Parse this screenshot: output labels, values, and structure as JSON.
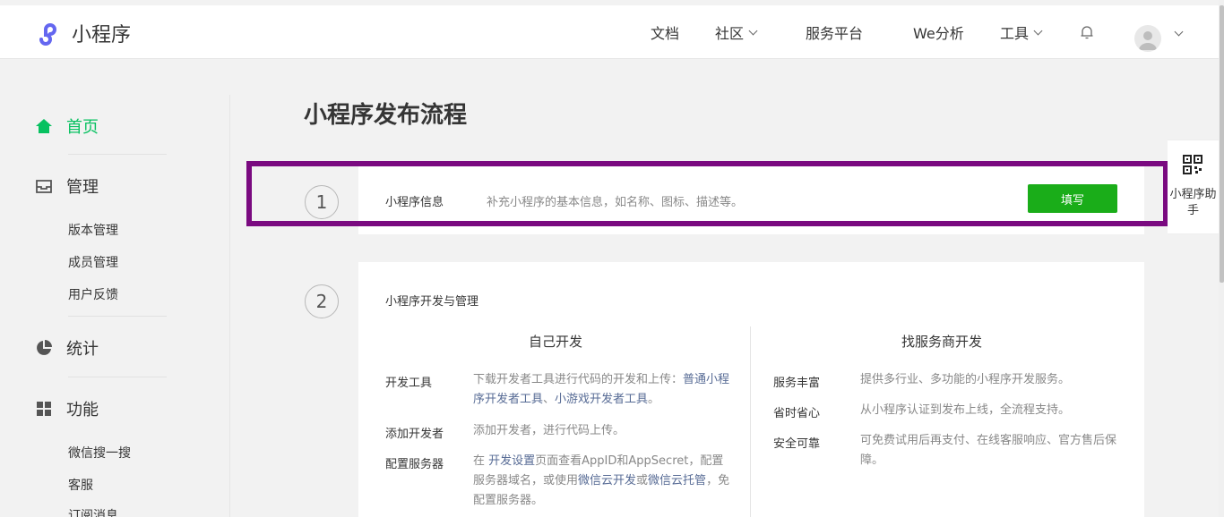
{
  "app": {
    "logo_text": "小程序"
  },
  "nav": {
    "docs": "文档",
    "community": "社区",
    "service_platform": "服务平台",
    "we_analysis": "We分析",
    "tools": "工具"
  },
  "sidebar": {
    "home": "首页",
    "manage": "管理",
    "manage_items": [
      "版本管理",
      "成员管理",
      "用户反馈"
    ],
    "stats": "统计",
    "features": "功能",
    "feature_items": [
      "微信搜一搜",
      "客服",
      "订阅消息"
    ]
  },
  "main": {
    "title": "小程序发布流程",
    "step1": {
      "num": "1",
      "label": "小程序信息",
      "desc": "补充小程序的基本信息，如名称、图标、描述等。",
      "button": "填写"
    },
    "step2": {
      "num": "2",
      "label": "小程序开发与管理",
      "self_dev": {
        "title": "自己开发",
        "rows": [
          {
            "key": "开发工具",
            "pre": "下载开发者工具进行代码的开发和上传：",
            "link1": "普通小程序开发者工具",
            "mid": "、",
            "link2": "小游戏开发者工具",
            "post": "。"
          },
          {
            "key": "添加开发者",
            "text": "添加开发者，进行代码上传。"
          },
          {
            "key": "配置服务器",
            "pre": "在 ",
            "link1": "开发设置",
            "mid": "页面查看AppID和AppSecret，配置服务器域名，或使用",
            "link2": "微信云开发",
            "mid2": "或",
            "link3": "微信云托管",
            "post": "，免配置服务器。"
          }
        ]
      },
      "provider_dev": {
        "title": "找服务商开发",
        "rows": [
          {
            "key": "服务丰富",
            "text": "提供多行业、多功能的小程序开发服务。"
          },
          {
            "key": "省时省心",
            "text": "从小程序认证到发布上线，全流程支持。"
          },
          {
            "key": "安全可靠",
            "text": "可免费试用后再支付、在线客服响应、官方售后保障。"
          }
        ]
      }
    }
  },
  "helper": {
    "text": "小程序助手"
  },
  "colors": {
    "accent": "#07c160",
    "button": "#1aad19",
    "link": "#576b95",
    "highlight": "#7a0a80"
  }
}
